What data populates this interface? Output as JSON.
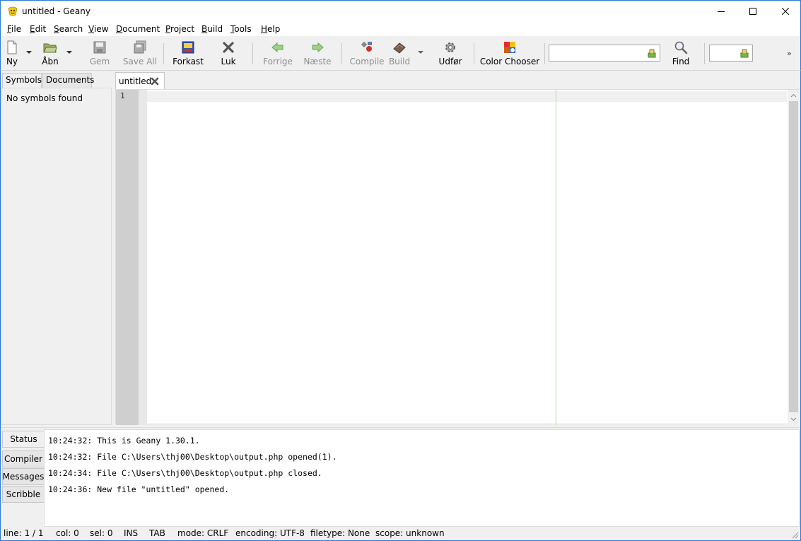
{
  "window": {
    "title": "untitled - Geany",
    "icon": "geany-app-icon"
  },
  "menu": [
    {
      "label": "File",
      "underline": "F",
      "rest": "ile"
    },
    {
      "label": "Edit",
      "underline": "E",
      "rest": "dit"
    },
    {
      "label": "Search",
      "underline": "S",
      "rest": "earch"
    },
    {
      "label": "View",
      "underline": "V",
      "rest": "iew"
    },
    {
      "label": "Document",
      "underline": "D",
      "rest": "ocument"
    },
    {
      "label": "Project",
      "underline": "P",
      "rest": "roject"
    },
    {
      "label": "Build",
      "underline": "B",
      "rest": "uild"
    },
    {
      "label": "Tools",
      "underline": "T",
      "rest": "ools"
    },
    {
      "label": "Help",
      "underline": "H",
      "rest": "elp"
    }
  ],
  "toolbar": {
    "new": {
      "label": "Ny",
      "icon": "new-file-icon",
      "enabled": true
    },
    "open": {
      "label": "Åbn",
      "icon": "open-folder-icon",
      "enabled": true
    },
    "save": {
      "label": "Gem",
      "icon": "save-icon",
      "enabled": false
    },
    "save_all": {
      "label": "Save All",
      "icon": "save-all-icon",
      "enabled": false
    },
    "revert": {
      "label": "Forkast",
      "icon": "revert-icon",
      "enabled": true
    },
    "close": {
      "label": "Luk",
      "icon": "close-icon",
      "enabled": true
    },
    "back": {
      "label": "Forrige",
      "icon": "arrow-left-icon",
      "enabled": false
    },
    "forward": {
      "label": "Næste",
      "icon": "arrow-right-icon",
      "enabled": false
    },
    "compile": {
      "label": "Compile",
      "icon": "compile-icon",
      "enabled": false
    },
    "build": {
      "label": "Build",
      "icon": "build-icon",
      "enabled": false
    },
    "execute": {
      "label": "Udfør",
      "icon": "gear-icon",
      "enabled": true
    },
    "color_chooser": {
      "label": "Color Chooser",
      "icon": "color-chooser-icon",
      "enabled": true
    },
    "search_value": "",
    "find": {
      "label": "Find",
      "icon": "magnifier-icon",
      "enabled": true
    },
    "goto_value": ""
  },
  "sidebar": {
    "tabs": [
      "Symbols",
      "Documents"
    ],
    "active_tab": "Symbols",
    "message": "No symbols found"
  },
  "editor": {
    "tab_label": "untitled",
    "line_numbers": [
      "1"
    ],
    "content": ""
  },
  "messages": {
    "tabs": [
      "Status",
      "Compiler",
      "Messages",
      "Scribble"
    ],
    "active_tab": "Status",
    "lines": [
      "10:24:32: This is Geany 1.30.1.",
      "10:24:32: File C:\\Users\\thj00\\Desktop\\output.php opened(1).",
      "10:24:34: File C:\\Users\\thj00\\Desktop\\output.php closed.",
      "10:24:36: New file \"untitled\" opened."
    ]
  },
  "statusbar": {
    "line": "line: 1 / 1",
    "col": "col: 0",
    "sel": "sel: 0",
    "ins": "INS",
    "tab": "TAB",
    "mode": "mode: CRLF",
    "encoding": "encoding: UTF-8",
    "filetype": "filetype: None",
    "scope": "scope: unknown"
  },
  "colors": {
    "frame": "#2b79d1",
    "long_line_marker": "#a8e0a0",
    "gutter": "#cfcfcf"
  }
}
